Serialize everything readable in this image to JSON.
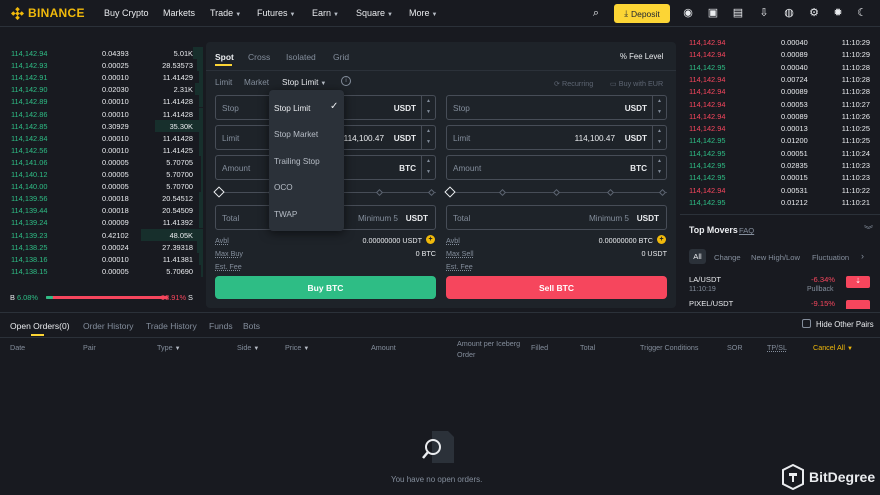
{
  "header": {
    "logo_text": "BINANCE",
    "nav": [
      "Buy Crypto",
      "Markets",
      "Trade",
      "Futures",
      "Earn",
      "Square",
      "More"
    ],
    "deposit_label": "Deposit"
  },
  "orderbook": {
    "rows": [
      {
        "price": "114,142.94",
        "amount": "0.04393",
        "total": "5.01K",
        "depth": 0.05
      },
      {
        "price": "114,142.93",
        "amount": "0.00025",
        "total": "28.53573",
        "depth": 0.03
      },
      {
        "price": "114,142.91",
        "amount": "0.00010",
        "total": "11.41429",
        "depth": 0.02
      },
      {
        "price": "114,142.90",
        "amount": "0.02030",
        "total": "2.31K",
        "depth": 0.04
      },
      {
        "price": "114,142.89",
        "amount": "0.00010",
        "total": "11.41428",
        "depth": 0.02
      },
      {
        "price": "114,142.86",
        "amount": "0.00010",
        "total": "11.41428",
        "depth": 0.02
      },
      {
        "price": "114,142.85",
        "amount": "0.30929",
        "total": "35.30K",
        "depth": 0.24
      },
      {
        "price": "114,142.84",
        "amount": "0.00010",
        "total": "11.41428",
        "depth": 0.02
      },
      {
        "price": "114,142.56",
        "amount": "0.00010",
        "total": "11.41425",
        "depth": 0.02
      },
      {
        "price": "114,141.06",
        "amount": "0.00005",
        "total": "5.70705",
        "depth": 0.01
      },
      {
        "price": "114,140.12",
        "amount": "0.00005",
        "total": "5.70700",
        "depth": 0.01
      },
      {
        "price": "114,140.00",
        "amount": "0.00005",
        "total": "5.70700",
        "depth": 0.01
      },
      {
        "price": "114,139.56",
        "amount": "0.00018",
        "total": "20.54512",
        "depth": 0.02
      },
      {
        "price": "114,139.44",
        "amount": "0.00018",
        "total": "20.54509",
        "depth": 0.02
      },
      {
        "price": "114,139.24",
        "amount": "0.00009",
        "total": "11.41392",
        "depth": 0.02
      },
      {
        "price": "114,139.23",
        "amount": "0.42102",
        "total": "48.05K",
        "depth": 0.31
      },
      {
        "price": "114,138.25",
        "amount": "0.00024",
        "total": "27.39318",
        "depth": 0.03
      },
      {
        "price": "114,138.16",
        "amount": "0.00010",
        "total": "11.41381",
        "depth": 0.02
      },
      {
        "price": "114,138.15",
        "amount": "0.00005",
        "total": "5.70690",
        "depth": 0.01
      }
    ],
    "buy_pct": "6.08%",
    "sell_pct": "93.91%",
    "buy_label": "B",
    "sell_label": "S",
    "buy_fraction": 0.0608
  },
  "form": {
    "tabs": [
      "Spot",
      "Cross",
      "Isolated",
      "Grid"
    ],
    "fee_level": "Fee Level",
    "order_types": [
      "Limit",
      "Market",
      "Stop Limit"
    ],
    "recurring": "Recurring",
    "buy_with": "Buy with EUR",
    "buy": {
      "stop_label": "Stop",
      "stop_unit": "USDT",
      "limit_label": "Limit",
      "limit_value": "114,100.47",
      "limit_unit": "USDT",
      "amount_label": "Amount",
      "amount_unit": "BTC",
      "total_label": "Total",
      "total_placeholder": "Minimum 5",
      "total_unit": "USDT",
      "avbl_label": "Avbl",
      "avbl_value": "0.00000000 USDT",
      "max_label": "Max Buy",
      "max_value": "0 BTC",
      "fee_label": "Est. Fee",
      "button": "Buy BTC"
    },
    "sell": {
      "stop_label": "Stop",
      "stop_unit": "USDT",
      "limit_label": "Limit",
      "limit_value": "114,100.47",
      "limit_unit": "USDT",
      "amount_label": "Amount",
      "amount_unit": "BTC",
      "total_label": "Total",
      "total_placeholder": "Minimum 5",
      "total_unit": "USDT",
      "avbl_label": "Avbl",
      "avbl_value": "0.00000000 BTC",
      "max_label": "Max Sell",
      "max_value": "0 USDT",
      "fee_label": "Est. Fee",
      "button": "Sell BTC"
    },
    "dropdown": [
      "Stop Limit",
      "Stop Market",
      "Trailing Stop",
      "OCO",
      "TWAP"
    ],
    "dropdown_selected": "Stop Limit"
  },
  "trades": {
    "rows": [
      {
        "price": "114,142.94",
        "amount": "0.00040",
        "time": "11:10:29",
        "side": "sell"
      },
      {
        "price": "114,142.94",
        "amount": "0.00089",
        "time": "11:10:29",
        "side": "sell"
      },
      {
        "price": "114,142.95",
        "amount": "0.00040",
        "time": "11:10:28",
        "side": "buy"
      },
      {
        "price": "114,142.94",
        "amount": "0.00724",
        "time": "11:10:28",
        "side": "sell"
      },
      {
        "price": "114,142.94",
        "amount": "0.00089",
        "time": "11:10:28",
        "side": "sell"
      },
      {
        "price": "114,142.94",
        "amount": "0.00053",
        "time": "11:10:27",
        "side": "sell"
      },
      {
        "price": "114,142.94",
        "amount": "0.00089",
        "time": "11:10:26",
        "side": "sell"
      },
      {
        "price": "114,142.94",
        "amount": "0.00013",
        "time": "11:10:25",
        "side": "sell"
      },
      {
        "price": "114,142.95",
        "amount": "0.01200",
        "time": "11:10:25",
        "side": "buy"
      },
      {
        "price": "114,142.95",
        "amount": "0.00051",
        "time": "11:10:24",
        "side": "buy"
      },
      {
        "price": "114,142.95",
        "amount": "0.02835",
        "time": "11:10:23",
        "side": "buy"
      },
      {
        "price": "114,142.95",
        "amount": "0.00015",
        "time": "11:10:23",
        "side": "buy"
      },
      {
        "price": "114,142.94",
        "amount": "0.00531",
        "time": "11:10:22",
        "side": "sell"
      },
      {
        "price": "114,142.95",
        "amount": "0.01212",
        "time": "11:10:21",
        "side": "buy"
      }
    ]
  },
  "movers": {
    "title": "Top Movers",
    "faq": "FAQ",
    "filters": [
      "All",
      "Change",
      "New High/Low",
      "Fluctuation"
    ],
    "items": [
      {
        "pair": "LA/USDT",
        "time": "11:10:19",
        "change": "-6.34%",
        "note": "Pullback"
      },
      {
        "pair": "PIXEL/USDT",
        "time": "",
        "change": "-9.15%",
        "note": ""
      }
    ]
  },
  "orders": {
    "tabs": [
      "Open Orders(0)",
      "Order History",
      "Trade History",
      "Funds",
      "Bots"
    ],
    "hide_other": "Hide Other Pairs",
    "columns": [
      "Date",
      "Pair",
      "Type",
      "Side",
      "Price",
      "Amount",
      "Amount per Iceberg Order",
      "Filled",
      "Total",
      "Trigger Conditions",
      "SOR",
      "TP/SL",
      "Cancel All"
    ],
    "empty": "You have no open orders."
  },
  "watermark": "BitDegree",
  "colors": {
    "accent": "#fcd535",
    "buy": "#2ebd85",
    "sell": "#f6465d"
  }
}
